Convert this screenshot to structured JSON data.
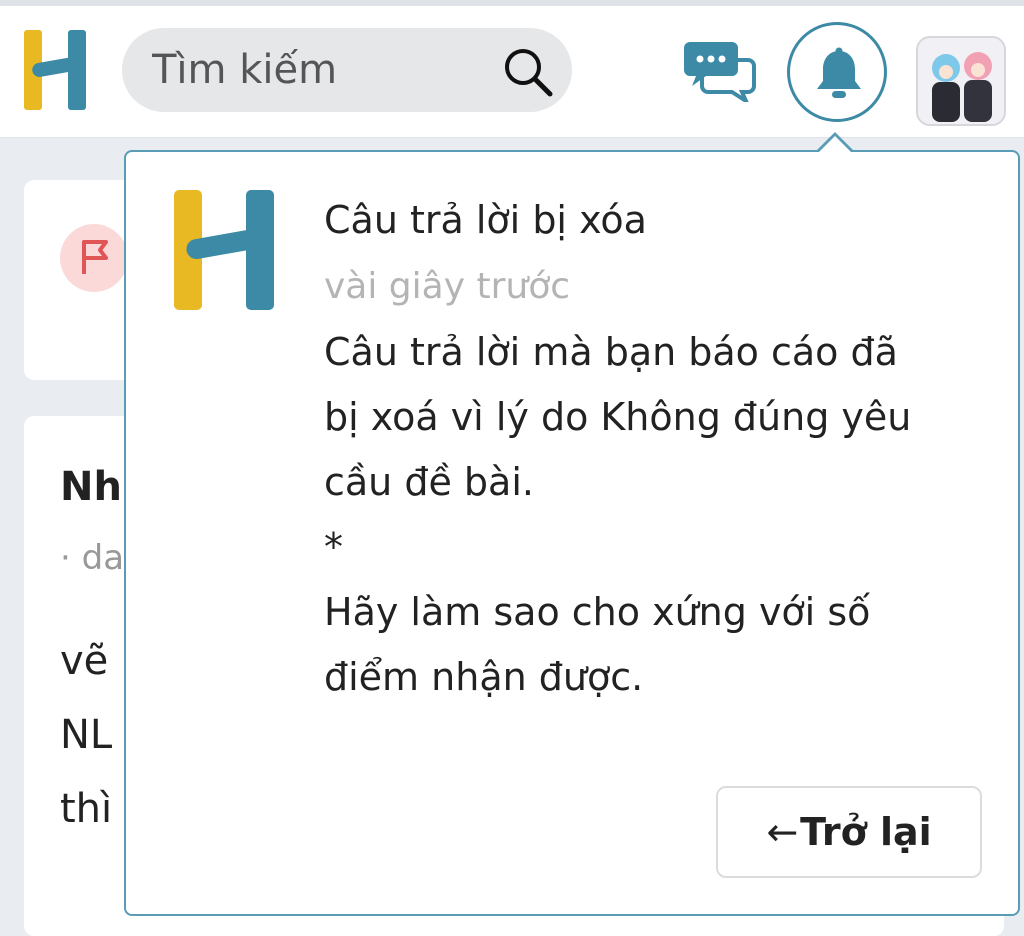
{
  "header": {
    "search": {
      "placeholder": "Tìm kiếm",
      "value": ""
    },
    "icons": {
      "logo": "hoc24-logo",
      "search": "search-icon",
      "messages": "chat-bubbles-icon",
      "notifications": "bell-icon",
      "avatar": "user-avatar"
    }
  },
  "background": {
    "author": "Nh",
    "meta": "· da",
    "lines": [
      "vẽ",
      "NL",
      "thì"
    ]
  },
  "notification": {
    "title": "Câu trả lời bị xóa",
    "time": "vài giây trước",
    "body_lines": [
      "Câu trả lời mà bạn báo cáo đã",
      "bị xoá vì lý do Không đúng yêu",
      "cầu đề bài.",
      "*",
      "Hãy làm sao cho xứng với số",
      "điểm nhận được."
    ],
    "back_arrow": "←",
    "back_label": "Trở lại"
  },
  "colors": {
    "accent": "#3d8aa6",
    "logo_yellow": "#e8b923",
    "logo_teal": "#3d8aa6",
    "flag_red": "#e05555"
  }
}
